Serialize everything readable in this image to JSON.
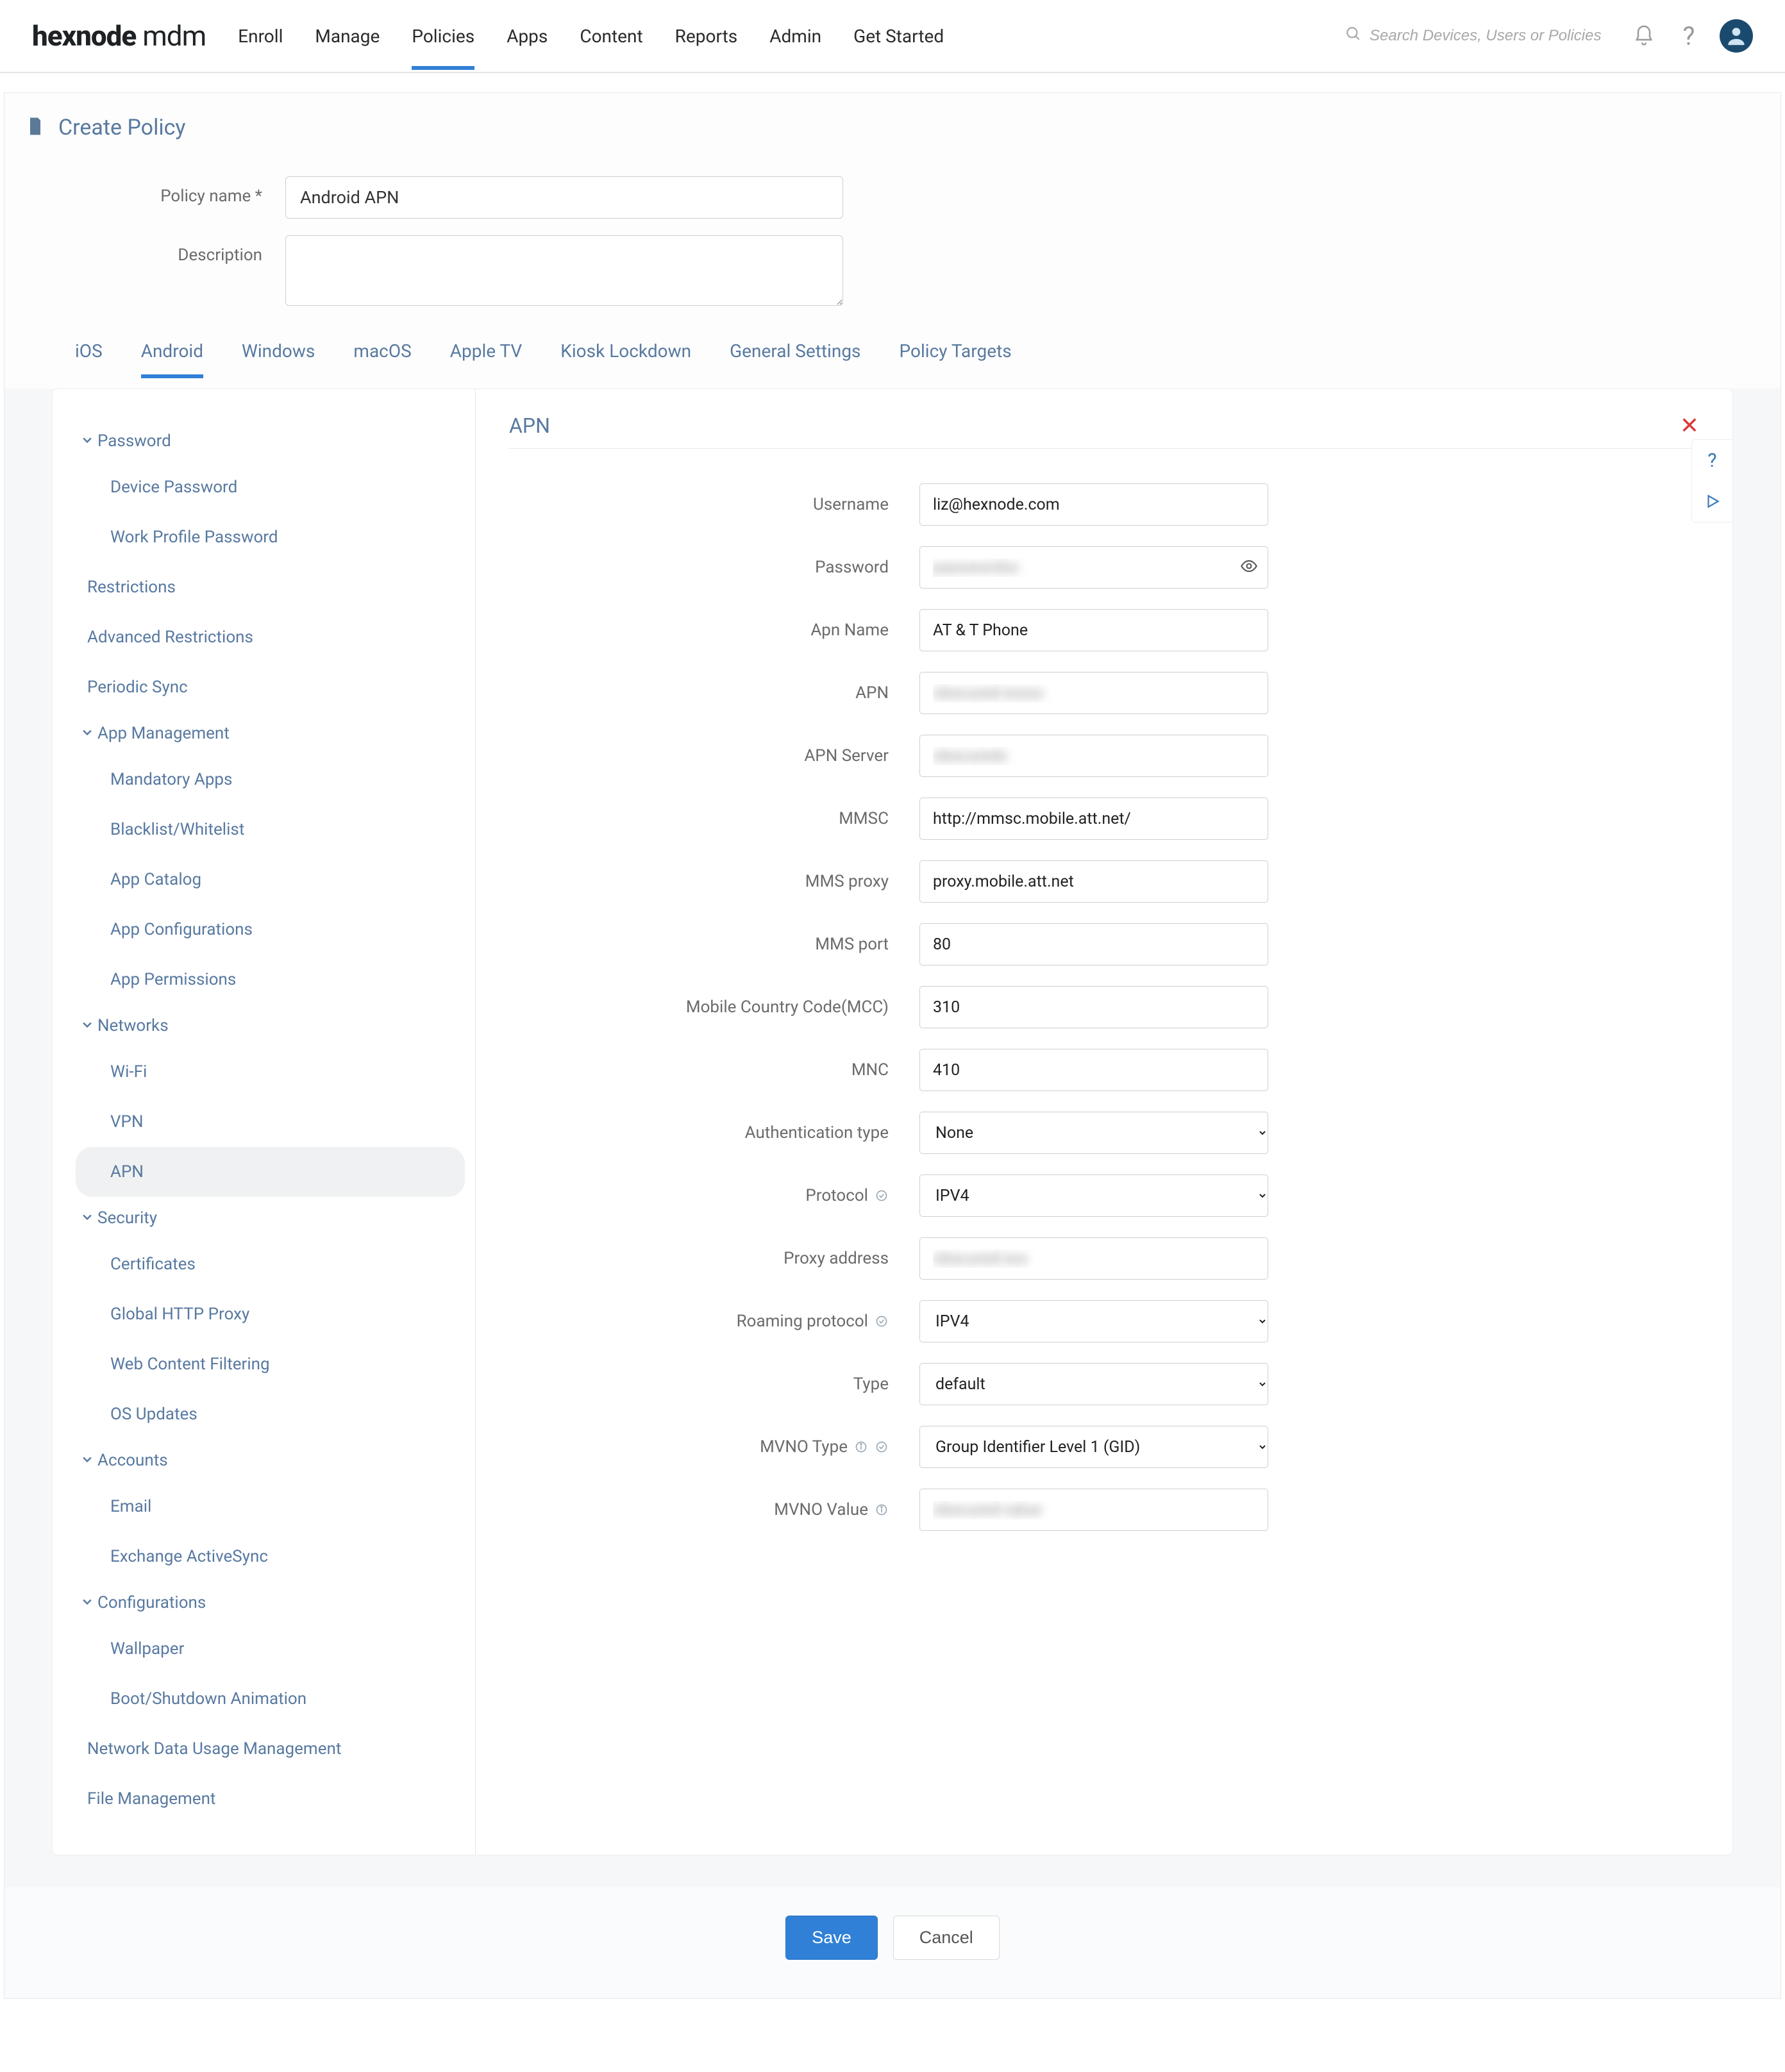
{
  "header": {
    "logo_bold": "hexnode",
    "logo_light": " mdm",
    "nav": [
      "Enroll",
      "Manage",
      "Policies",
      "Apps",
      "Content",
      "Reports",
      "Admin",
      "Get Started"
    ],
    "nav_active_index": 2,
    "search_placeholder": "Search Devices, Users or Policies"
  },
  "page": {
    "title": "Create Policy",
    "policy_name_label": "Policy name *",
    "policy_name_value": "Android APN",
    "description_label": "Description",
    "description_value": ""
  },
  "platform_tabs": {
    "items": [
      "iOS",
      "Android",
      "Windows",
      "macOS",
      "Apple TV",
      "Kiosk Lockdown",
      "General Settings",
      "Policy Targets"
    ],
    "active_index": 1
  },
  "sidebar": {
    "groups": [
      {
        "label": "Password",
        "items": [
          "Device Password",
          "Work Profile Password"
        ]
      },
      {
        "label": "Restrictions",
        "flat": true
      },
      {
        "label": "Advanced Restrictions",
        "flat": true
      },
      {
        "label": "Periodic Sync",
        "flat": true
      },
      {
        "label": "App Management",
        "items": [
          "Mandatory Apps",
          "Blacklist/Whitelist",
          "App Catalog",
          "App Configurations",
          "App Permissions"
        ]
      },
      {
        "label": "Networks",
        "items": [
          "Wi-Fi",
          "VPN",
          "APN"
        ],
        "active_item_index": 2
      },
      {
        "label": "Security",
        "items": [
          "Certificates",
          "Global HTTP Proxy",
          "Web Content Filtering",
          "OS Updates"
        ]
      },
      {
        "label": "Accounts",
        "items": [
          "Email",
          "Exchange ActiveSync"
        ]
      },
      {
        "label": "Configurations",
        "items": [
          "Wallpaper",
          "Boot/Shutdown Animation"
        ]
      },
      {
        "label": "Network Data Usage Management",
        "flat": true
      },
      {
        "label": "File Management",
        "flat": true
      }
    ]
  },
  "form": {
    "title": "APN",
    "fields": {
      "username": {
        "label": "Username",
        "value": "liz@hexnode.com"
      },
      "password": {
        "label": "Password",
        "value": "••••••••"
      },
      "apn_name": {
        "label": "Apn Name",
        "value": "AT & T Phone"
      },
      "apn": {
        "label": "APN",
        "value": "obscured"
      },
      "apn_server": {
        "label": "APN Server",
        "value": "obscured"
      },
      "mmsc": {
        "label": "MMSC",
        "value": "http://mmsc.mobile.att.net/"
      },
      "mms_proxy": {
        "label": "MMS proxy",
        "value": "proxy.mobile.att.net"
      },
      "mms_port": {
        "label": "MMS port",
        "value": "80"
      },
      "mcc": {
        "label": "Mobile Country Code(MCC)",
        "value": "310"
      },
      "mnc": {
        "label": "MNC",
        "value": "410"
      },
      "auth_type": {
        "label": "Authentication type",
        "value": "None"
      },
      "protocol": {
        "label": "Protocol",
        "value": "IPV4"
      },
      "proxy_address": {
        "label": "Proxy address",
        "value": "obscured"
      },
      "roaming_protocol": {
        "label": "Roaming protocol",
        "value": "IPV4"
      },
      "type": {
        "label": "Type",
        "value": "default"
      },
      "mvno_type": {
        "label": "MVNO Type",
        "value": "Group Identifier Level 1 (GID)"
      },
      "mvno_value": {
        "label": "MVNO Value",
        "value": "obscured"
      }
    }
  },
  "footer": {
    "save": "Save",
    "cancel": "Cancel"
  }
}
